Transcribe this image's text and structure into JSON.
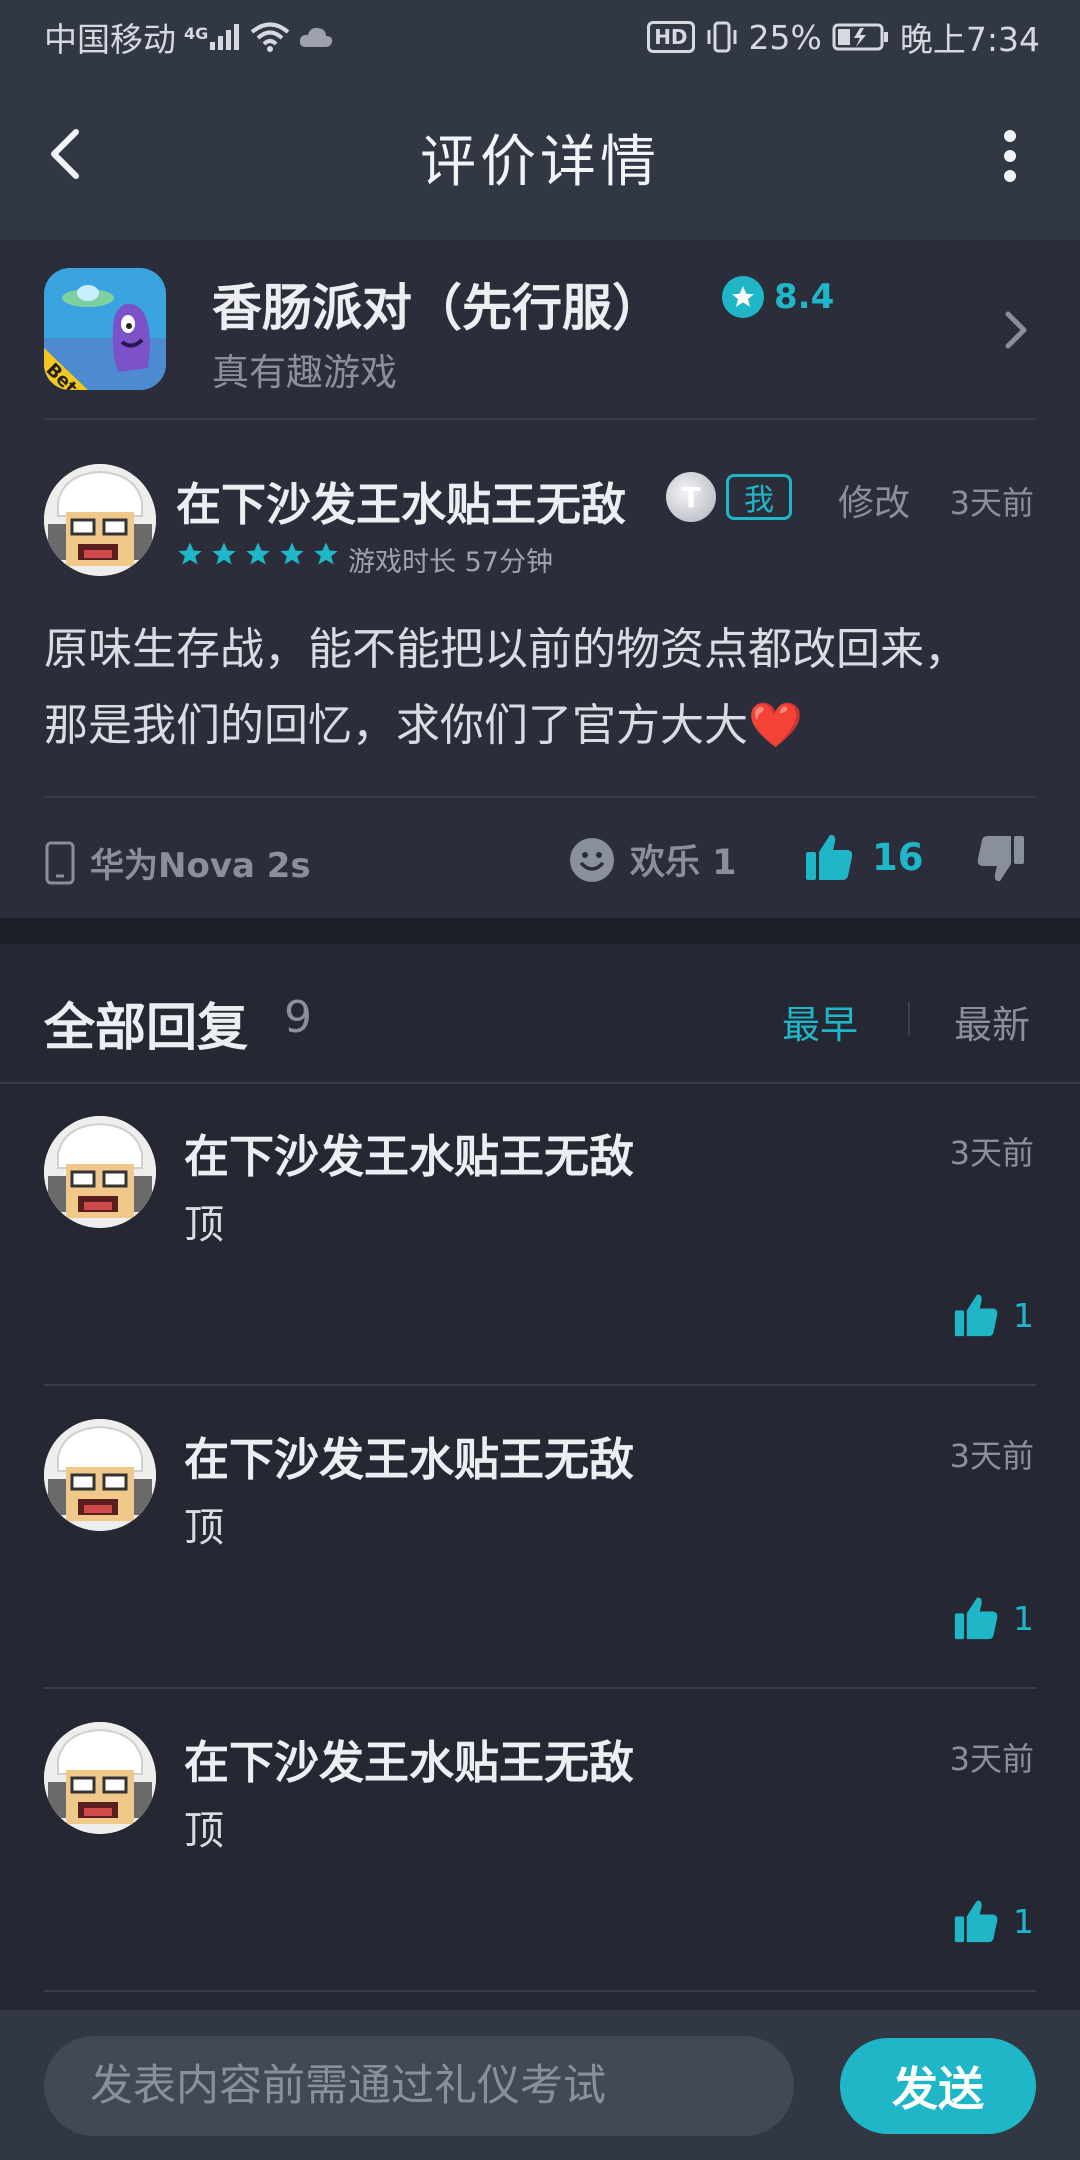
{
  "status_bar": {
    "carrier": "中国移动",
    "network": "4G",
    "hd": "HD",
    "battery": "25%",
    "time": "晚上7:34"
  },
  "app_bar": {
    "title": "评价详情"
  },
  "game": {
    "name": "香肠派对（先行服）",
    "score": "8.4",
    "subtitle": "真有趣游戏",
    "icon_badge": "Beta"
  },
  "review": {
    "author": "在下沙发王水贴王无敌",
    "level_badge": "T",
    "me_tag": "我",
    "edit_label": "修改",
    "time": "3天前",
    "rating": 5,
    "play_time": "游戏时长 57分钟",
    "text": "原味生存战，能不能把以前的物资点都改回来，那是我们的回忆，求你们了官方大大",
    "text_emoji": "❤️",
    "device": "华为Nova 2s",
    "emote_label": "欢乐 1",
    "like_count": "16"
  },
  "replies_header": {
    "title": "全部回复",
    "count": "9",
    "sort_earliest": "最早",
    "sort_latest": "最新"
  },
  "replies": [
    {
      "author": "在下沙发王水贴王无敌",
      "time": "3天前",
      "text": "顶",
      "likes": "1"
    },
    {
      "author": "在下沙发王水贴王无敌",
      "time": "3天前",
      "text": "顶",
      "likes": "1"
    },
    {
      "author": "在下沙发王水贴王无敌",
      "time": "3天前",
      "text": "顶",
      "likes": "1"
    }
  ],
  "composer": {
    "placeholder": "发表内容前需通过礼仪考试",
    "send_label": "发送"
  },
  "colors": {
    "accent": "#1fb6c8",
    "background": "#252833",
    "card": "#2b2e3a",
    "bar": "#323744",
    "heart": "#c0272d"
  }
}
